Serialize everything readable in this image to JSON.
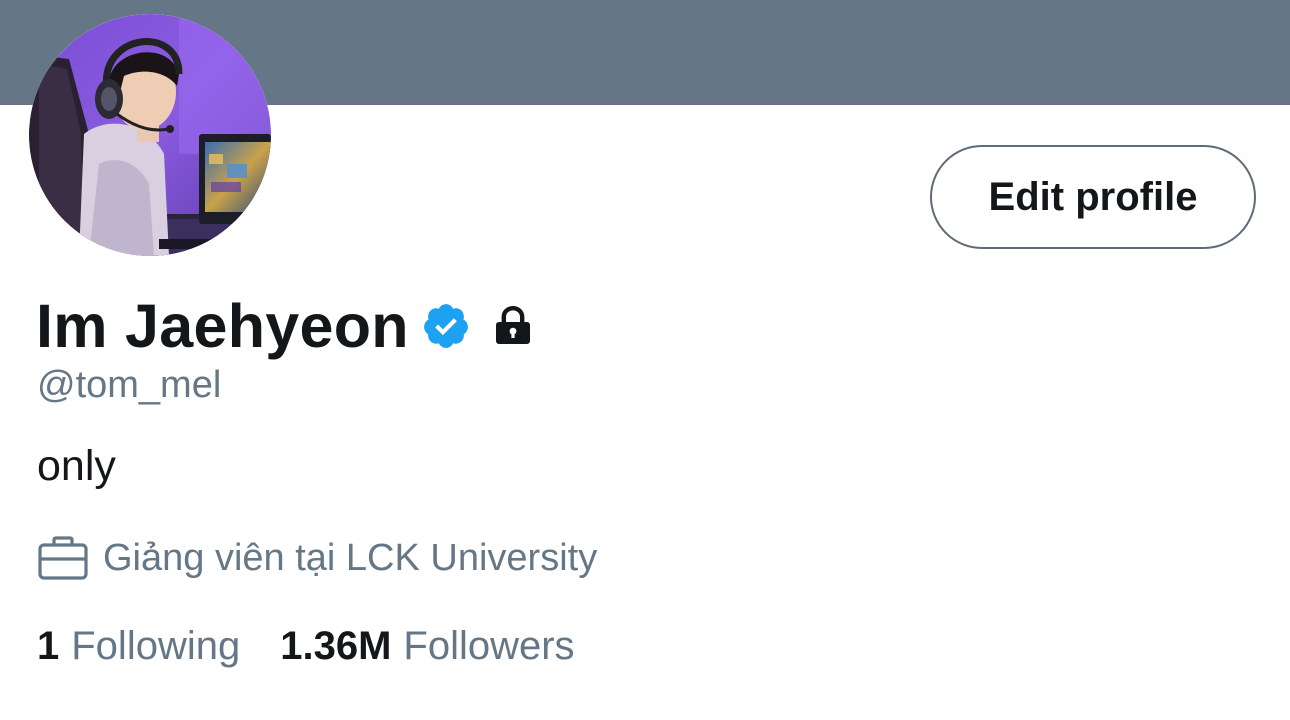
{
  "profile": {
    "display_name": "Im Jaehyeon",
    "handle": "@tom_mel",
    "bio": "only",
    "job": "Giảng viên tại LCK University",
    "edit_label": "Edit profile",
    "verified": true,
    "protected": true
  },
  "stats": {
    "following_count": "1",
    "following_label": "Following",
    "followers_count": "1.36M",
    "followers_label": "Followers"
  },
  "icons": {
    "verified": "verified-badge-icon",
    "lock": "lock-icon",
    "job": "briefcase-icon"
  },
  "colors": {
    "banner": "#657786",
    "verified_blue": "#1da1f2",
    "text_primary": "#14171a",
    "text_secondary": "#657786"
  }
}
